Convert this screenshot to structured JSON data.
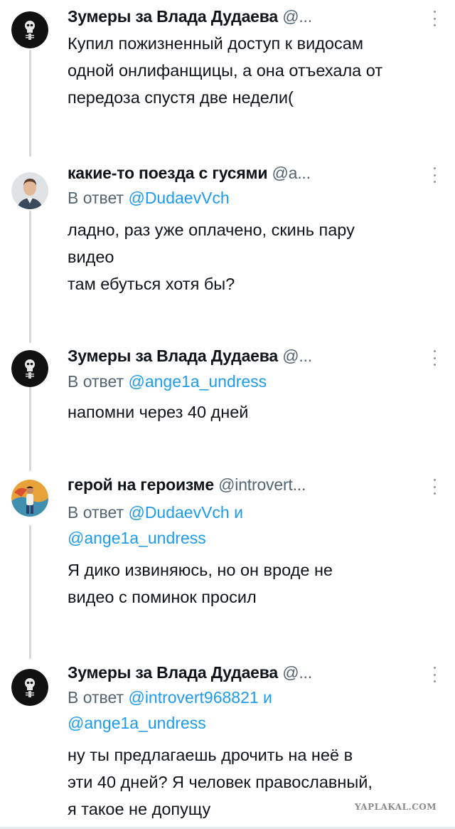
{
  "tweets": [
    {
      "name": "Зумеры за Влада Дудаева",
      "handle": "@...",
      "avatar": "black-circle-skull-avatar",
      "reply": null,
      "body": [
        "Купил пожизненный доступ к видосам",
        "одной онлифанщицы, а она отъехала от",
        "передоза спустя две недели("
      ]
    },
    {
      "name": "какие-то поезда с гусями",
      "handle": "@а...",
      "avatar": "man-portrait-avatar",
      "reply": {
        "prefix": "В ответ",
        "mention1": "@DudaevVch",
        "conj": "",
        "mention2": ""
      },
      "body": [
        "ладно, раз уже оплачено, скинь пару",
        "видео",
        "там ебуться хотя бы?"
      ]
    },
    {
      "name": "Зумеры за Влада Дудаева",
      "handle": "@...",
      "avatar": "black-circle-skull-avatar",
      "reply": {
        "prefix": "В ответ",
        "mention1": "@ange1a_undress",
        "conj": "",
        "mention2": ""
      },
      "body": [
        "напомни через 40 дней"
      ]
    },
    {
      "name": "герой на героизме",
      "handle": "@introvert...",
      "avatar": "colorful-man-illustration-avatar",
      "reply": {
        "prefix": "В ответ",
        "mention1": "@DudaevVch",
        "conj": "и",
        "mention2": "@ange1a_undress"
      },
      "body": [
        "Я дико извиняюсь, но он вроде не",
        "видео с поминок просил"
      ]
    },
    {
      "name": "Зумеры за Влада Дудаева",
      "handle": "@...",
      "avatar": "black-circle-skull-avatar",
      "reply": {
        "prefix": "В ответ",
        "mention1": "@introvert968821",
        "conj": "и",
        "mention2": "@ange1a_undress"
      },
      "body": [
        "ну ты предлагаешь дрочить на неё в",
        "эти 40 дней? Я человек православный,",
        "я такое не допущу"
      ]
    }
  ],
  "watermark": "YAPLAKAL.COM",
  "colors": {
    "link": "#1d9bf0",
    "secondary": "#536471",
    "thread": "#cfd9de"
  }
}
